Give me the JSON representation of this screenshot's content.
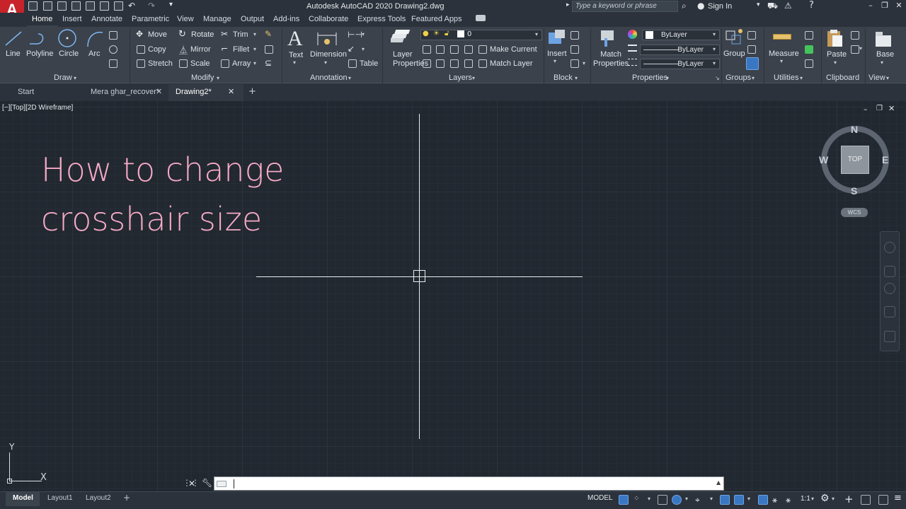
{
  "app": {
    "logo": "A",
    "title": "Autodesk AutoCAD 2020    Drawing2.dwg",
    "search_placeholder": "Type a keyword or phrase",
    "signin": "Sign In"
  },
  "menu_tabs": [
    "Home",
    "Insert",
    "Annotate",
    "Parametric",
    "View",
    "Manage",
    "Output",
    "Add-ins",
    "Collaborate",
    "Express Tools",
    "Featured Apps"
  ],
  "ribbon": {
    "draw": {
      "title": "Draw",
      "line": "Line",
      "polyline": "Polyline",
      "circle": "Circle",
      "arc": "Arc"
    },
    "modify": {
      "title": "Modify",
      "move": "Move",
      "rotate": "Rotate",
      "trim": "Trim",
      "copy": "Copy",
      "mirror": "Mirror",
      "fillet": "Fillet",
      "stretch": "Stretch",
      "scale": "Scale",
      "array": "Array"
    },
    "annotation": {
      "title": "Annotation",
      "text": "Text",
      "dimension": "Dimension",
      "table": "Table",
      "text_glyph": "A"
    },
    "layers": {
      "title": "Layers",
      "layer_properties": "Layer Properties",
      "layer_value": "0",
      "make_current": "Make Current",
      "match_layer": "Match Layer"
    },
    "block": {
      "title": "Block",
      "insert": "Insert"
    },
    "properties": {
      "title": "Properties",
      "match_properties": "Match Properties",
      "color": "ByLayer",
      "linetype": "ByLayer",
      "lineweight": "ByLayer"
    },
    "groups": {
      "title": "Groups",
      "group": "Group"
    },
    "utilities": {
      "title": "Utilities",
      "measure": "Measure"
    },
    "clipboard": {
      "title": "Clipboard",
      "paste": "Paste"
    },
    "view": {
      "title": "View",
      "base": "Base"
    }
  },
  "file_tabs": [
    "Start",
    "Mera ghar_recover*",
    "Drawing2*"
  ],
  "viewport": {
    "label": "[−][Top][2D Wireframe]",
    "headline_line1": "How to change",
    "headline_line2": "crosshair size"
  },
  "viewcube": {
    "top": "TOP",
    "n": "N",
    "s": "S",
    "e": "E",
    "w": "W",
    "wcs": "WCS"
  },
  "ucs": {
    "x": "X",
    "y": "Y"
  },
  "layout_tabs": [
    "Model",
    "Layout1",
    "Layout2"
  ],
  "status": {
    "model": "MODEL",
    "scale": "1:1"
  },
  "colors": {
    "headline": "#f7a9c6",
    "background": "#212830",
    "ribbon": "#3b424c",
    "accent": "#3a77c2"
  }
}
